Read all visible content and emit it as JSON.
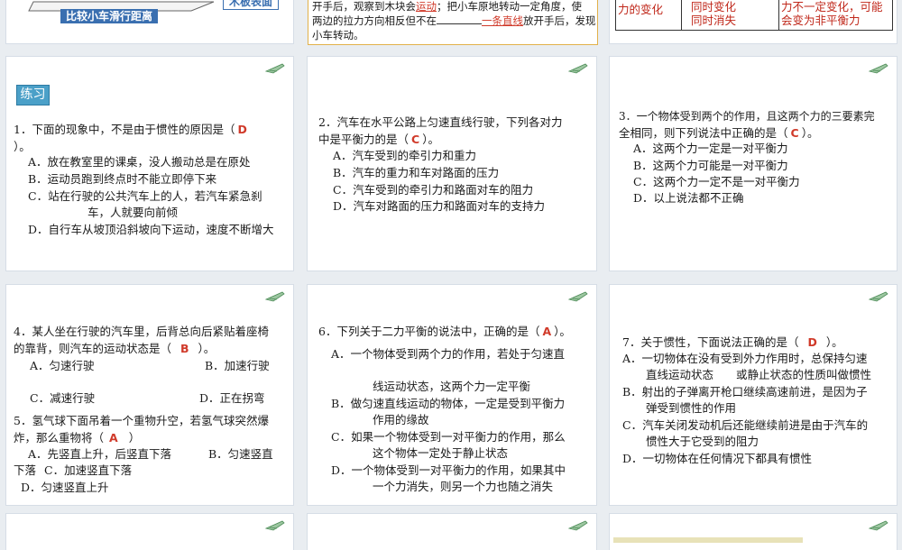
{
  "top_row": {
    "left": {
      "label1": "比较小车滑行距离",
      "label2": "木板表面"
    },
    "middle": {
      "line1_pre": "开手后，观察到木块会",
      "line1_ans": "运动",
      "line1_post": "；把小车原地转动一定角度，使",
      "line2_pre": "两边的拉力方向相反但不在",
      "line2_ans": "一条直线",
      "line2_post": "放开手后，发现",
      "line3": "小车转动。"
    },
    "right": {
      "c1": "力的变化",
      "c2a": "同时变化",
      "c2b": "同时消失",
      "c3a": "力不一定变化，可能",
      "c3b": "会变为非平衡力"
    }
  },
  "lianxi": "练习",
  "q1": {
    "stem_pre": "1．下面的现象中，不是由于惯性的原因是（",
    "answer": "D",
    "stem_post": "）。",
    "a": "A．放在教室里的课桌，没人搬动总是在原处",
    "b": "B．运动员跑到终点时不能立即停下来",
    "c1": "C．站在行驶的公共汽车上的人，若汽车紧急刹",
    "c2": "车，人就要向前倾",
    "d": "D．自行车从坡顶沿斜坡向下运动，速度不断增大"
  },
  "q2": {
    "stem1": "2．汽车在水平公路上匀速直线行驶，下列各对力",
    "stem2_pre": "中是平衡力的是（",
    "answer": "C",
    "stem2_post": "）。",
    "a": "A．汽车受到的牵引力和重力",
    "b": "B．汽车的重力和车对路面的压力",
    "c": "C．汽车受到的牵引力和路面对车的阻力",
    "d": "D．汽车对路面的压力和路面对车的支持力"
  },
  "q3": {
    "stem1": "3．一个物体受到两个的作用，且这两个力的三要素完",
    "stem2_pre": "全相同，则下列说法中正确的是（",
    "answer": "C",
    "stem2_post": "）。",
    "a": "A．这两个力一定是一对平衡力",
    "b": "B．这两个力可能是一对平衡力",
    "c": "C．这两个力一定不是一对平衡力",
    "d": "D．以上说法都不正确"
  },
  "q4": {
    "stem1": "4．某人坐在行驶的汽车里，后背总向后紧贴着座椅",
    "stem2_pre": "的靠背，则汽车的运动状态是（",
    "answer": "B",
    "stem2_post": "）。",
    "a": "A．匀速行驶",
    "b": "B．加速行驶",
    "c": "C．减速行驶",
    "d": "D．正在拐弯"
  },
  "q5": {
    "stem1": "5．氢气球下面吊着一个重物升空，若氢气球突然爆",
    "stem2_pre": "炸，那么重物将（",
    "answer": "A",
    "stem2_post": "）",
    "a": "A．先竖直上升，后竖直下落",
    "b1": "B．匀速竖直",
    "b2": "下落",
    "c": "C．加速竖直下落",
    "d": "D．匀速竖直上升"
  },
  "q6": {
    "stem_pre": "6．下列关于二力平衡的说法中，正确的是（",
    "answer": "A",
    "stem_post": "）。",
    "a1": "A．一个物体受到两个力的作用，若处于匀速直",
    "a2": "线运动状态，这两个力一定平衡",
    "b1": "B．做匀速直线运动的物体，一定是受到平衡力",
    "b2": "作用的缘故",
    "c1": "C．如果一个物体受到一对平衡力的作用，那么",
    "c2": "这个物体一定处于静止状态",
    "d1": "D．一个物体受到一对平衡力的作用，如果其中",
    "d2": "一个力消失，则另一个力也随之消失"
  },
  "q7": {
    "stem_pre": "7．关于惯性，下面说法正确的是（",
    "answer": "D",
    "stem_post": "）。",
    "a1": "A．一切物体在没有受到外力作用时，总保持匀速",
    "a2": "直线运动状态　　或静止状态的性质叫做惯性",
    "b1": "B．射出的子弹离开枪口继续高速前进，是因为子",
    "b2": "弹受到惯性的作用",
    "c1": "C．汽车关闭发动机后还能继续前进是由于汽车的",
    "c2": "惯性大于它受到的阻力",
    "d": "D．一切物体在任何情况下都具有惯性"
  },
  "colors": {
    "answer": "#d03a2a",
    "accent": "#4ba0c8",
    "background": "#e9edf1"
  },
  "icons": [
    "corner-plane-icon"
  ]
}
